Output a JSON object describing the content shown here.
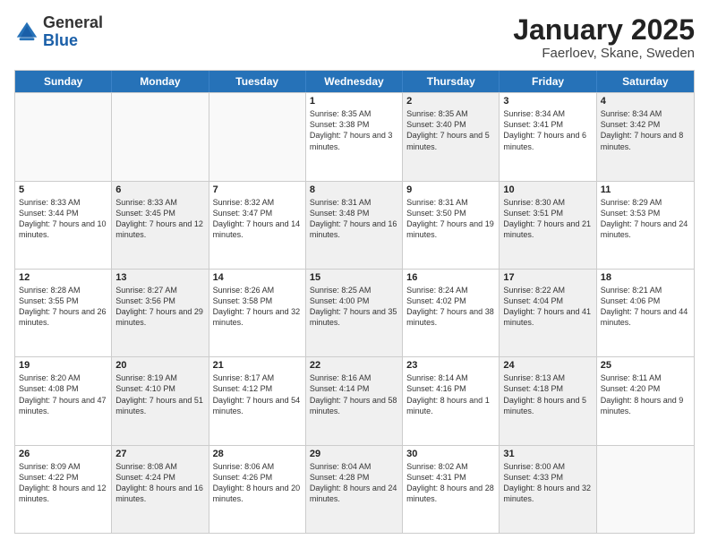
{
  "logo": {
    "general": "General",
    "blue": "Blue"
  },
  "header": {
    "title": "January 2025",
    "subtitle": "Faerloev, Skane, Sweden"
  },
  "weekdays": [
    "Sunday",
    "Monday",
    "Tuesday",
    "Wednesday",
    "Thursday",
    "Friday",
    "Saturday"
  ],
  "weeks": [
    [
      {
        "day": "",
        "info": "",
        "shaded": false,
        "empty": true
      },
      {
        "day": "",
        "info": "",
        "shaded": false,
        "empty": true
      },
      {
        "day": "",
        "info": "",
        "shaded": false,
        "empty": true
      },
      {
        "day": "1",
        "info": "Sunrise: 8:35 AM\nSunset: 3:38 PM\nDaylight: 7 hours\nand 3 minutes.",
        "shaded": false,
        "empty": false
      },
      {
        "day": "2",
        "info": "Sunrise: 8:35 AM\nSunset: 3:40 PM\nDaylight: 7 hours\nand 5 minutes.",
        "shaded": true,
        "empty": false
      },
      {
        "day": "3",
        "info": "Sunrise: 8:34 AM\nSunset: 3:41 PM\nDaylight: 7 hours\nand 6 minutes.",
        "shaded": false,
        "empty": false
      },
      {
        "day": "4",
        "info": "Sunrise: 8:34 AM\nSunset: 3:42 PM\nDaylight: 7 hours\nand 8 minutes.",
        "shaded": true,
        "empty": false
      }
    ],
    [
      {
        "day": "5",
        "info": "Sunrise: 8:33 AM\nSunset: 3:44 PM\nDaylight: 7 hours\nand 10 minutes.",
        "shaded": false,
        "empty": false
      },
      {
        "day": "6",
        "info": "Sunrise: 8:33 AM\nSunset: 3:45 PM\nDaylight: 7 hours\nand 12 minutes.",
        "shaded": true,
        "empty": false
      },
      {
        "day": "7",
        "info": "Sunrise: 8:32 AM\nSunset: 3:47 PM\nDaylight: 7 hours\nand 14 minutes.",
        "shaded": false,
        "empty": false
      },
      {
        "day": "8",
        "info": "Sunrise: 8:31 AM\nSunset: 3:48 PM\nDaylight: 7 hours\nand 16 minutes.",
        "shaded": true,
        "empty": false
      },
      {
        "day": "9",
        "info": "Sunrise: 8:31 AM\nSunset: 3:50 PM\nDaylight: 7 hours\nand 19 minutes.",
        "shaded": false,
        "empty": false
      },
      {
        "day": "10",
        "info": "Sunrise: 8:30 AM\nSunset: 3:51 PM\nDaylight: 7 hours\nand 21 minutes.",
        "shaded": true,
        "empty": false
      },
      {
        "day": "11",
        "info": "Sunrise: 8:29 AM\nSunset: 3:53 PM\nDaylight: 7 hours\nand 24 minutes.",
        "shaded": false,
        "empty": false
      }
    ],
    [
      {
        "day": "12",
        "info": "Sunrise: 8:28 AM\nSunset: 3:55 PM\nDaylight: 7 hours\nand 26 minutes.",
        "shaded": false,
        "empty": false
      },
      {
        "day": "13",
        "info": "Sunrise: 8:27 AM\nSunset: 3:56 PM\nDaylight: 7 hours\nand 29 minutes.",
        "shaded": true,
        "empty": false
      },
      {
        "day": "14",
        "info": "Sunrise: 8:26 AM\nSunset: 3:58 PM\nDaylight: 7 hours\nand 32 minutes.",
        "shaded": false,
        "empty": false
      },
      {
        "day": "15",
        "info": "Sunrise: 8:25 AM\nSunset: 4:00 PM\nDaylight: 7 hours\nand 35 minutes.",
        "shaded": true,
        "empty": false
      },
      {
        "day": "16",
        "info": "Sunrise: 8:24 AM\nSunset: 4:02 PM\nDaylight: 7 hours\nand 38 minutes.",
        "shaded": false,
        "empty": false
      },
      {
        "day": "17",
        "info": "Sunrise: 8:22 AM\nSunset: 4:04 PM\nDaylight: 7 hours\nand 41 minutes.",
        "shaded": true,
        "empty": false
      },
      {
        "day": "18",
        "info": "Sunrise: 8:21 AM\nSunset: 4:06 PM\nDaylight: 7 hours\nand 44 minutes.",
        "shaded": false,
        "empty": false
      }
    ],
    [
      {
        "day": "19",
        "info": "Sunrise: 8:20 AM\nSunset: 4:08 PM\nDaylight: 7 hours\nand 47 minutes.",
        "shaded": false,
        "empty": false
      },
      {
        "day": "20",
        "info": "Sunrise: 8:19 AM\nSunset: 4:10 PM\nDaylight: 7 hours\nand 51 minutes.",
        "shaded": true,
        "empty": false
      },
      {
        "day": "21",
        "info": "Sunrise: 8:17 AM\nSunset: 4:12 PM\nDaylight: 7 hours\nand 54 minutes.",
        "shaded": false,
        "empty": false
      },
      {
        "day": "22",
        "info": "Sunrise: 8:16 AM\nSunset: 4:14 PM\nDaylight: 7 hours\nand 58 minutes.",
        "shaded": true,
        "empty": false
      },
      {
        "day": "23",
        "info": "Sunrise: 8:14 AM\nSunset: 4:16 PM\nDaylight: 8 hours\nand 1 minute.",
        "shaded": false,
        "empty": false
      },
      {
        "day": "24",
        "info": "Sunrise: 8:13 AM\nSunset: 4:18 PM\nDaylight: 8 hours\nand 5 minutes.",
        "shaded": true,
        "empty": false
      },
      {
        "day": "25",
        "info": "Sunrise: 8:11 AM\nSunset: 4:20 PM\nDaylight: 8 hours\nand 9 minutes.",
        "shaded": false,
        "empty": false
      }
    ],
    [
      {
        "day": "26",
        "info": "Sunrise: 8:09 AM\nSunset: 4:22 PM\nDaylight: 8 hours\nand 12 minutes.",
        "shaded": false,
        "empty": false
      },
      {
        "day": "27",
        "info": "Sunrise: 8:08 AM\nSunset: 4:24 PM\nDaylight: 8 hours\nand 16 minutes.",
        "shaded": true,
        "empty": false
      },
      {
        "day": "28",
        "info": "Sunrise: 8:06 AM\nSunset: 4:26 PM\nDaylight: 8 hours\nand 20 minutes.",
        "shaded": false,
        "empty": false
      },
      {
        "day": "29",
        "info": "Sunrise: 8:04 AM\nSunset: 4:28 PM\nDaylight: 8 hours\nand 24 minutes.",
        "shaded": true,
        "empty": false
      },
      {
        "day": "30",
        "info": "Sunrise: 8:02 AM\nSunset: 4:31 PM\nDaylight: 8 hours\nand 28 minutes.",
        "shaded": false,
        "empty": false
      },
      {
        "day": "31",
        "info": "Sunrise: 8:00 AM\nSunset: 4:33 PM\nDaylight: 8 hours\nand 32 minutes.",
        "shaded": true,
        "empty": false
      },
      {
        "day": "",
        "info": "",
        "shaded": false,
        "empty": true
      }
    ]
  ]
}
